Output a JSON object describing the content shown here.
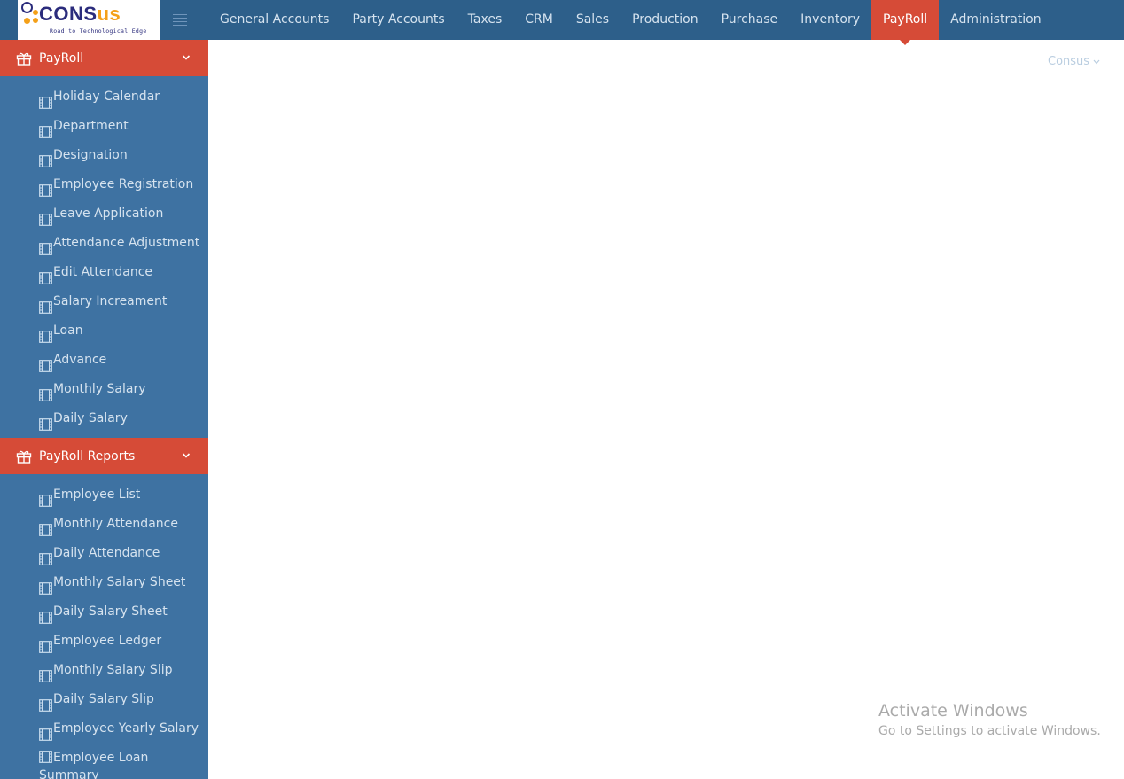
{
  "logo": {
    "brand_part1": "CONS",
    "brand_part2": "us",
    "tagline": "Road to Technological Edge"
  },
  "colors": {
    "topbar": "#2d5f8a",
    "sidebar": "#3e72a2",
    "accent": "#d64b37"
  },
  "nav": {
    "items": [
      {
        "label": "General Accounts",
        "active": false
      },
      {
        "label": "Party Accounts",
        "active": false
      },
      {
        "label": "Taxes",
        "active": false
      },
      {
        "label": "CRM",
        "active": false
      },
      {
        "label": "Sales",
        "active": false
      },
      {
        "label": "Production",
        "active": false
      },
      {
        "label": "Purchase",
        "active": false
      },
      {
        "label": "Inventory",
        "active": false
      },
      {
        "label": "PayRoll",
        "active": true
      },
      {
        "label": "Administration",
        "active": false
      }
    ]
  },
  "sidebar": {
    "sections": [
      {
        "title": "PayRoll",
        "items": [
          "Holiday Calendar",
          "Department",
          "Designation",
          "Employee Registration",
          "Leave Application",
          "Attendance Adjustment",
          "Edit Attendance",
          "Salary Increament",
          "Loan",
          "Advance",
          "Monthly Salary",
          "Daily Salary"
        ]
      },
      {
        "title": "PayRoll Reports",
        "items": [
          "Employee List",
          "Monthly Attendance",
          "Daily Attendance",
          "Monthly Salary Sheet",
          "Daily Salary Sheet",
          "Employee Ledger",
          "Monthly Salary Slip",
          "Daily Salary Slip",
          "Employee Yearly Salary",
          "Employee Loan Summary"
        ]
      }
    ]
  },
  "user_menu": {
    "label": "Consus"
  },
  "watermark": {
    "title": "Activate Windows",
    "subtitle": "Go to Settings to activate Windows."
  }
}
